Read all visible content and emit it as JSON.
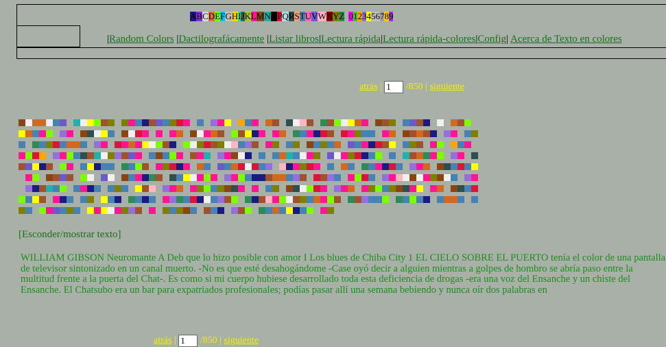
{
  "legend": [
    "A",
    "B",
    "C",
    "D",
    "E",
    "F",
    "G",
    "H",
    "I",
    "J",
    "K",
    "L",
    "M",
    "N",
    "O",
    "P",
    "Q",
    "R",
    "S",
    "T",
    "U",
    "V",
    "W",
    "X",
    "Y",
    "Z",
    " ",
    "0",
    "1",
    "2",
    "3",
    "4",
    "5",
    "6",
    "7",
    "8",
    "9"
  ],
  "legend_colors": [
    "#1a1a80",
    "#8a2be2",
    "#d8d8d8",
    "#e06a3a",
    "#7cfc00",
    "#00bfff",
    "#c0c0c0",
    "#ffd700",
    "#00fa9a",
    "#555555",
    "#9acd32",
    "#ff1493",
    "#8b4513",
    "#20b2aa",
    "#000000",
    "#dc143c",
    "#b0e0e6",
    "#2f4f4f",
    "#ffa07a",
    "#4682b4",
    "#ff69b4",
    "#6a5acd",
    "#ffb6c1",
    "#800000",
    "#808000",
    "#2e8b57",
    "#a9b0a8",
    "#ff00ff",
    "#32cd32",
    "#ffa500",
    "#9370db",
    "#ffff00",
    "#c0c0c0",
    "#bfbfbf",
    "#a0a0a0",
    "#ffcc00",
    "#9933cc"
  ],
  "palette": [
    "#2e8b57",
    "#ffa500",
    "#1a1a80",
    "#7cfc00",
    "#dc143c",
    "#4682b4",
    "#ffff00",
    "#8b4513",
    "#9370db",
    "#ff1493",
    "#ffb6c1",
    "#20b2aa",
    "#2f4f4f",
    "#f0f0f0",
    "#000000",
    "#ff69b4",
    "#d2691e",
    "#6a5acd",
    "#808000",
    "#a0522d"
  ],
  "nav": {
    "random_colors": "Random Colors",
    "typing": "Dactilografácamente",
    "list_books": "Listar libros",
    "speed_read": "Lectura rápida",
    "speed_read_colors": "Lectura rápida-colores",
    "config": "Config",
    "about": "Acerca de Texto en colores"
  },
  "pager": {
    "prev": "atrás",
    "page": "1",
    "total": "/850",
    "next": "siguiente"
  },
  "toggle_text": "[Esconder/mostrar texto]",
  "text": "WILLIAM GIBSON Neuromante A Deb que lo hizo posible con amor I Los blues de Chiba City 1 EL CIELO SOBRE EL PUERTO tenía el color de una pantalla de televisor sintonizado en un canal muerto. -No es que esté desahogándome -Case oyó decir a alguien mientras a golpes de hombro se abría paso entre la multitud frente a la puerta del Chat-. Es como si mi cuerpo hubiese desarrollado toda esta deficiencia de drogas -era una voz del Ensanche y un chiste del Ensanche. El Chatsubo era un bar para expatriados profesionales; podías pasar allí una semana bebiendo y nunca oír dos palabras en"
}
